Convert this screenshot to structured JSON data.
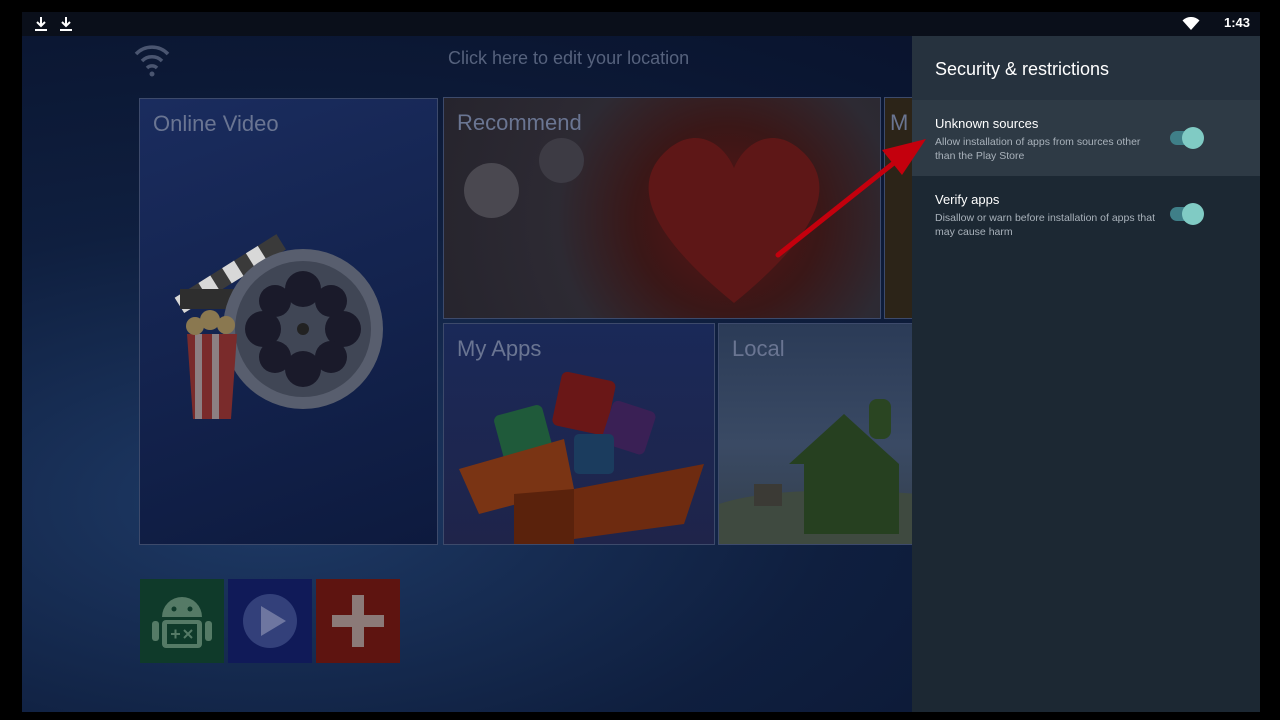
{
  "status_bar": {
    "left_icons": [
      "download-icon",
      "download-icon"
    ],
    "right_icons": [
      "wifi-icon"
    ],
    "time": "1:43"
  },
  "launcher": {
    "location_text": "Click here to edit your location",
    "tiles": {
      "online_video": "Online Video",
      "recommend": "Recommend",
      "more": "M",
      "my_apps": "My Apps",
      "local": "Local"
    },
    "shortcut_icons": [
      "android-calculator-icon",
      "play-icon",
      "plus-icon"
    ]
  },
  "settings_panel": {
    "title": "Security & restrictions",
    "items": [
      {
        "title": "Unknown sources",
        "description": "Allow installation of apps from sources other than the Play Store",
        "enabled": true
      },
      {
        "title": "Verify apps",
        "description": "Disallow or warn before installation of apps that may cause harm",
        "enabled": true
      }
    ]
  },
  "colors": {
    "panel_background": "#1c2833",
    "highlight_row": "#2e3a45",
    "toggle_on": "#80cbc4",
    "annotation_arrow": "#c4000d"
  }
}
